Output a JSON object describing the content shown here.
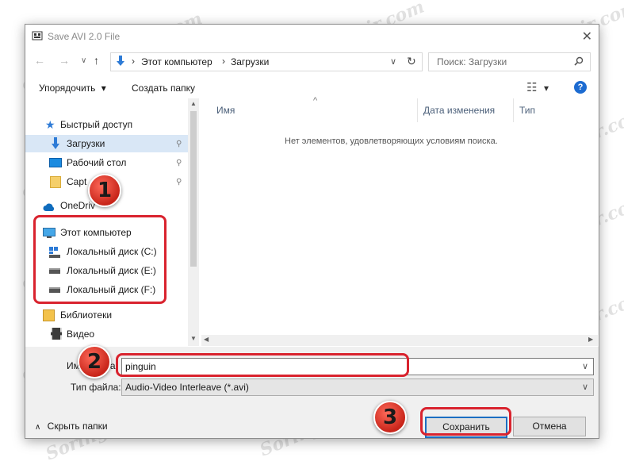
{
  "dialog": {
    "title": "Save AVI 2.0 File",
    "close_glyph": "✕"
  },
  "address": {
    "back_glyph": "←",
    "forward_glyph": "→",
    "recent_glyph": "∨",
    "up_glyph": "↑",
    "crumbs": [
      "Этот компьютер",
      "Загрузки"
    ],
    "separator": "›",
    "dropdown_glyph": "∨",
    "refresh_glyph": "↻",
    "search_placeholder": "Поиск: Загрузки",
    "search_glyph": "⚲"
  },
  "toolbar": {
    "organize_label": "Упорядочить",
    "organize_arrow": "▾",
    "new_folder_label": "Создать папку",
    "view_glyph": "☷",
    "view_arrow": "▾",
    "help_glyph": "?"
  },
  "sidebar": {
    "quick_access": "Быстрый доступ",
    "downloads": "Загрузки",
    "desktop": "Рабочий стол",
    "capture": "Capt",
    "onedrive": "OneDriv",
    "this_pc": "Этот компьютер",
    "disk_c": "Локальный диск (C:)",
    "disk_e": "Локальный диск (E:)",
    "disk_f": "Локальный диск (F:)",
    "libraries": "Библиотеки",
    "video": "Видео",
    "pin_glyph": "📌"
  },
  "columns": {
    "name": "Имя",
    "date": "Дата изменения",
    "type": "Тип",
    "sort_glyph": "^"
  },
  "content": {
    "empty_message": "Нет элементов, удовлетворяющих условиям поиска."
  },
  "form": {
    "filename_label": "Им",
    "filename_label_tail": "а",
    "filename_value": "pinguin",
    "filetype_label": "Тип файла:",
    "filetype_value": "Audio-Video Interleave (*.avi)",
    "dropdown_glyph": "∨"
  },
  "footer": {
    "hide_folders_glyph": "∧",
    "hide_folders_label": "Скрыть папки",
    "save_label": "Сохранить",
    "cancel_label": "Отмена"
  },
  "annotations": {
    "badge1": "1",
    "badge2": "2",
    "badge3": "3",
    "accent": "#d9232e"
  },
  "watermark": {
    "text": "Soringpcrepair.com"
  }
}
